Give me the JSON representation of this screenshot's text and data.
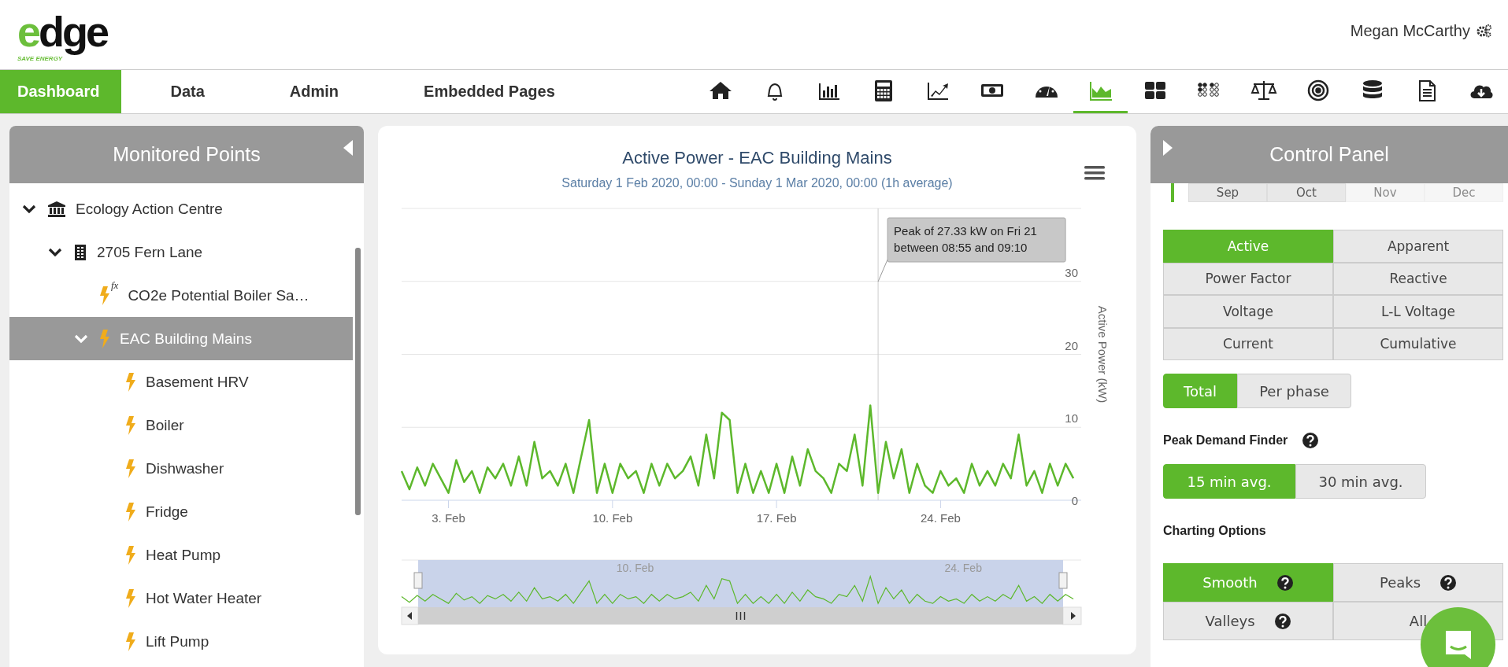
{
  "header": {
    "logo": {
      "word": "edge",
      "tagline": "SAVE ENERGY"
    },
    "user": "Megan McCarthy"
  },
  "nav": {
    "tabs": [
      {
        "label": "Dashboard",
        "selected": true
      },
      {
        "label": "Data",
        "selected": false
      },
      {
        "label": "Admin",
        "selected": false
      },
      {
        "label": "Embedded Pages",
        "selected": false
      }
    ],
    "tools": [
      {
        "selected": false
      },
      {
        "selected": false
      },
      {
        "selected": false
      },
      {
        "selected": false
      },
      {
        "selected": false
      },
      {
        "selected": false
      },
      {
        "selected": false
      },
      {
        "selected": true
      },
      {
        "selected": false
      },
      {
        "selected": false
      },
      {
        "selected": false
      },
      {
        "selected": false
      },
      {
        "selected": false
      },
      {
        "selected": false
      },
      {
        "selected": false
      }
    ]
  },
  "monitored_points": {
    "title": "Monitored Points",
    "tree": [
      {
        "label": "Ecology Action Centre",
        "kind": "site",
        "expanded": true,
        "selected": false,
        "children": [
          {
            "label": "2705 Fern Lane",
            "kind": "building",
            "expanded": true,
            "selected": false,
            "children": [
              {
                "label": "CO2e Potential Boiler Sa…",
                "kind": "virtual",
                "badge": "fx",
                "selected": false
              },
              {
                "label": "EAC Building Mains",
                "kind": "meter",
                "expanded": true,
                "selected": true,
                "children": [
                  {
                    "label": "Basement HRV",
                    "kind": "meter",
                    "selected": false
                  },
                  {
                    "label": "Boiler",
                    "kind": "meter",
                    "selected": false
                  },
                  {
                    "label": "Dishwasher",
                    "kind": "meter",
                    "selected": false
                  },
                  {
                    "label": "Fridge",
                    "kind": "meter",
                    "selected": false
                  },
                  {
                    "label": "Heat Pump",
                    "kind": "meter",
                    "selected": false
                  },
                  {
                    "label": "Hot Water Heater",
                    "kind": "meter",
                    "selected": false
                  },
                  {
                    "label": "Lift Pump",
                    "kind": "meter",
                    "selected": false
                  }
                ]
              }
            ]
          }
        ]
      }
    ]
  },
  "chart": {
    "chart_data": {
      "type": "line",
      "title": "Active Power - EAC Building Mains",
      "subtitle": "Saturday 1 Feb 2020, 00:00 - Sunday 1 Mar 2020, 00:00 (1h average)",
      "ylabel": "Active Power (kW)",
      "categories": [
        null,
        null,
        null,
        null,
        null,
        null,
        "3. Feb",
        null,
        null,
        null,
        null,
        null,
        null,
        null,
        null,
        null,
        null,
        null,
        null,
        null,
        null,
        null,
        null,
        null,
        null,
        null,
        null,
        "10. Feb",
        null,
        null,
        null,
        null,
        null,
        null,
        null,
        null,
        null,
        null,
        null,
        null,
        null,
        null,
        null,
        null,
        null,
        null,
        null,
        null,
        "17. Feb",
        null,
        null,
        null,
        null,
        null,
        null,
        null,
        null,
        null,
        null,
        null,
        null,
        null,
        null,
        null,
        null,
        null,
        null,
        null,
        null,
        "24. Feb",
        null,
        null,
        null,
        null,
        null,
        null,
        null,
        null,
        null,
        null,
        null,
        null,
        null,
        null,
        null,
        null,
        null
      ],
      "series": [
        {
          "color": "#5db82c",
          "values": [
            4,
            1.5,
            4.5,
            2,
            5,
            3,
            1,
            5.5,
            2.5,
            4,
            1,
            4.5,
            3,
            5,
            2,
            6,
            2,
            8,
            3,
            4,
            2,
            5,
            1,
            6,
            11,
            1,
            5,
            1,
            5,
            3,
            4,
            1,
            5,
            2,
            5,
            3,
            4,
            6,
            2,
            9,
            3,
            12,
            11,
            1,
            5,
            1,
            4,
            1,
            5,
            1,
            6,
            2,
            7,
            4,
            3,
            1,
            5,
            4,
            9,
            2,
            13,
            1,
            8,
            3,
            7,
            1,
            5,
            2,
            1,
            4,
            2,
            3,
            1,
            5,
            2,
            4,
            2,
            5,
            3,
            9,
            2,
            4,
            1,
            5,
            2,
            5,
            3
          ]
        }
      ],
      "ylim": [
        0,
        40
      ],
      "yticks": [
        0,
        10,
        20,
        30
      ],
      "grid": true
    },
    "tooltip": {
      "lines": [
        "Peak of 27.33 kW on Fri 21",
        "between 08:55 and 09:10"
      ]
    },
    "navigator_labels": [
      "10. Feb",
      "24. Feb"
    ]
  },
  "control_panel": {
    "title": "Control Panel",
    "months": [
      {
        "label": "Sep",
        "disabled": false
      },
      {
        "label": "Oct",
        "disabled": false
      },
      {
        "label": "Nov",
        "disabled": true
      },
      {
        "label": "Dec",
        "disabled": true
      }
    ],
    "measures": [
      {
        "label": "Active",
        "selected": true
      },
      {
        "label": "Apparent",
        "selected": false
      },
      {
        "label": "Power Factor",
        "selected": false
      },
      {
        "label": "Reactive",
        "selected": false
      },
      {
        "label": "Voltage",
        "selected": false
      },
      {
        "label": "L-L Voltage",
        "selected": false
      },
      {
        "label": "Current",
        "selected": false
      },
      {
        "label": "Cumulative",
        "selected": false
      }
    ],
    "phase": [
      {
        "label": "Total",
        "selected": true
      },
      {
        "label": "Per phase",
        "selected": false
      }
    ],
    "peak_label": "Peak Demand Finder",
    "peak": [
      {
        "label": "15 min avg.",
        "selected": true
      },
      {
        "label": "30 min avg.",
        "selected": false
      }
    ],
    "charting_label": "Charting Options",
    "charting": [
      {
        "label": "Smooth",
        "selected": true,
        "help": true
      },
      {
        "label": "Peaks",
        "selected": false,
        "help": true
      },
      {
        "label": "Valleys",
        "selected": false,
        "help": true
      },
      {
        "label": "All",
        "selected": false,
        "help": false
      }
    ]
  }
}
